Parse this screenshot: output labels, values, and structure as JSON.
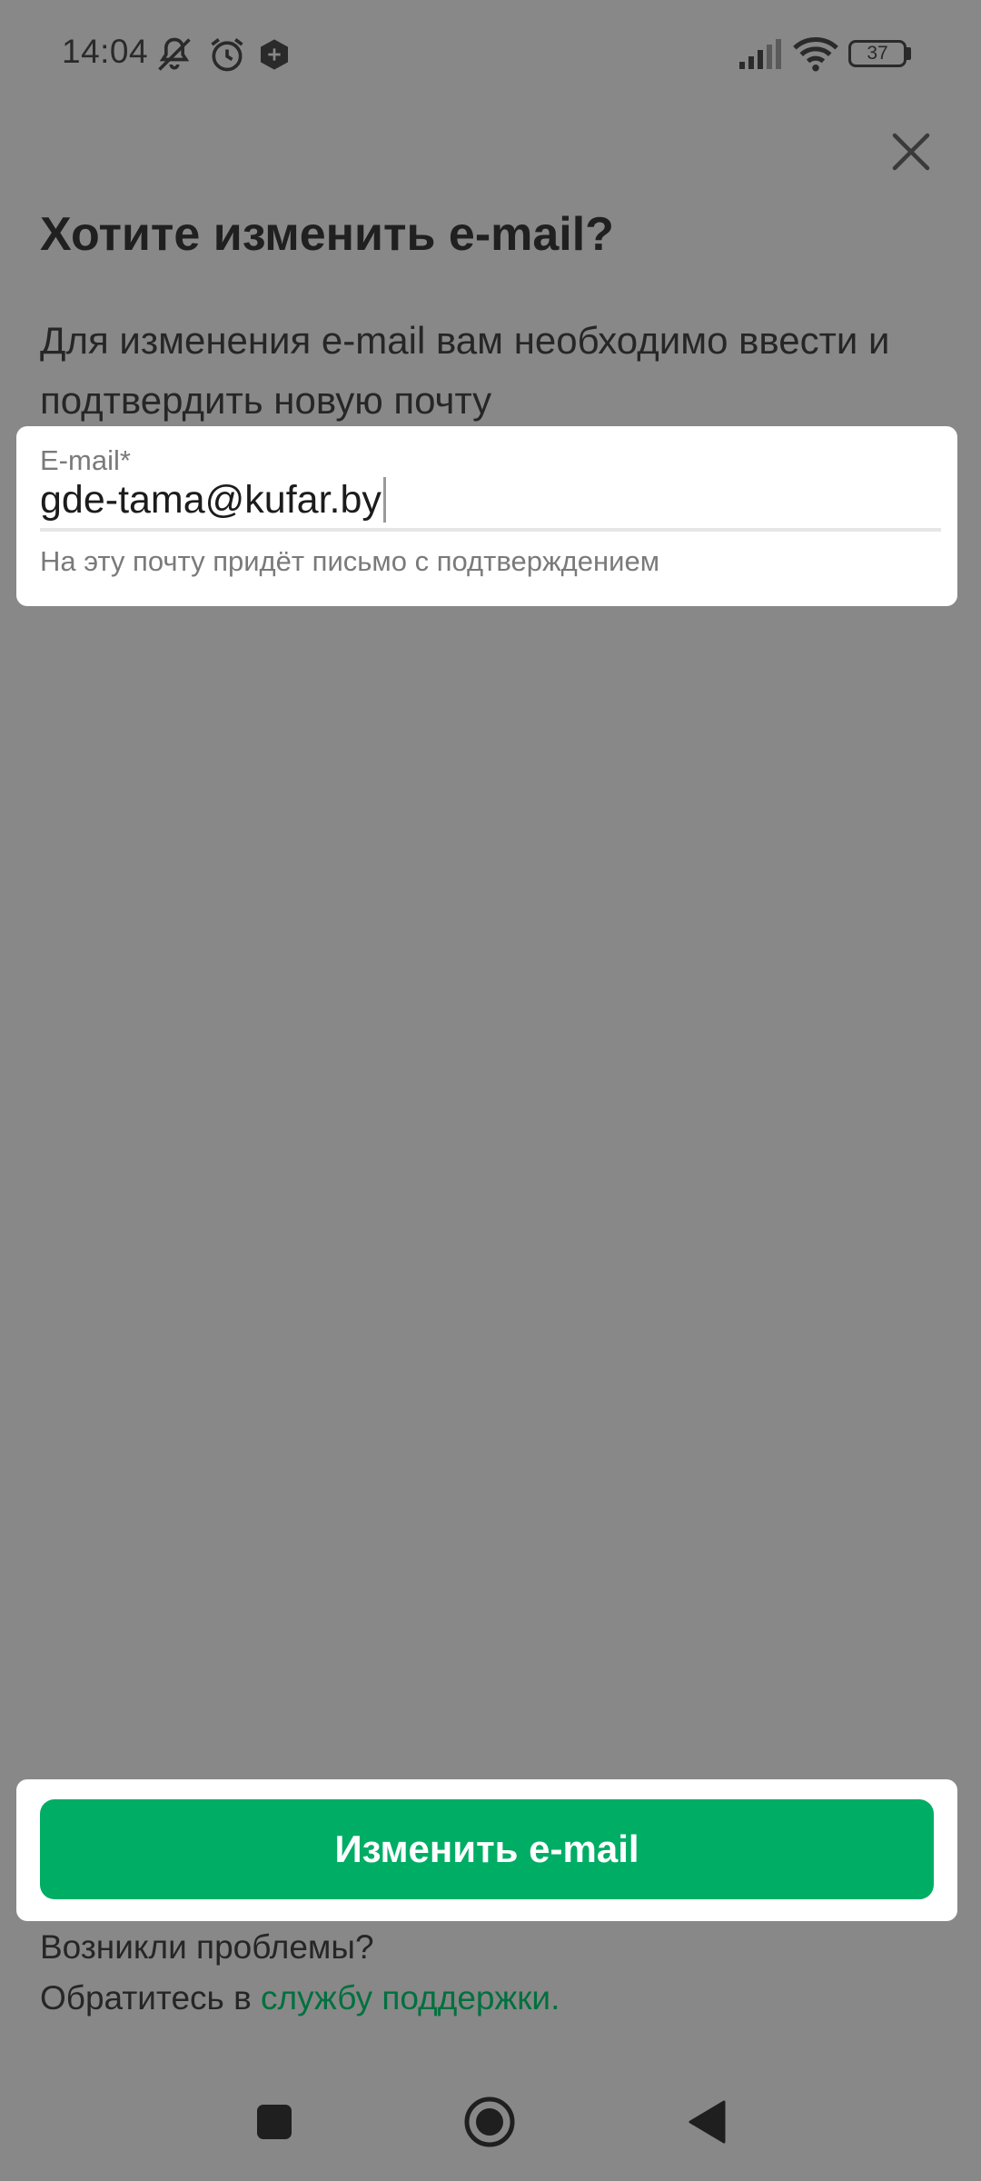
{
  "status_bar": {
    "time": "14:04",
    "battery_level": "37",
    "icons": [
      "mute-icon",
      "alarm-icon",
      "vpn-icon",
      "signal-icon",
      "wifi-icon",
      "battery-icon"
    ]
  },
  "dialog": {
    "close_icon": "close-icon",
    "title": "Хотите изменить e-mail?",
    "description": "Для изменения e-mail вам необходимо ввести и подтвердить новую почту"
  },
  "email_field": {
    "label": "E-mail*",
    "value": "gde-tama@kufar.by",
    "hint": "На эту почту придёт письмо с подтверждением"
  },
  "actions": {
    "submit_label": "Изменить e-mail"
  },
  "help": {
    "line1": "Возникли проблемы?",
    "line2_prefix": "Обратитесь в ",
    "support_link": "службу поддержки."
  },
  "nav": {
    "icons": [
      "recents-icon",
      "home-icon",
      "back-icon"
    ]
  },
  "colors": {
    "overlay_background": "#888888",
    "accent_green": "#00ad65",
    "link_green": "#00703f"
  }
}
